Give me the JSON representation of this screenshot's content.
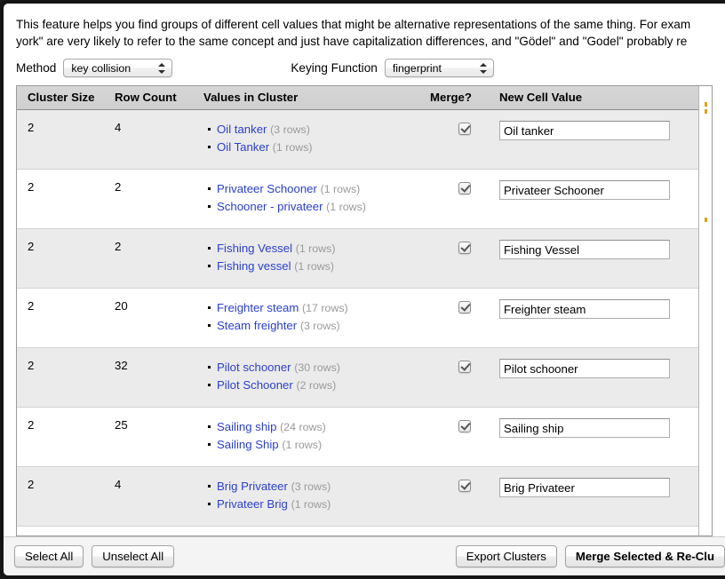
{
  "intro": {
    "line1": "This feature helps you find groups of different cell values that might be alternative representations of the same thing. For exam",
    "line2": "york\" are very likely to refer to the same concept and just have capitalization differences, and \"Gödel\" and \"Godel\" probably re"
  },
  "controls": {
    "method_label": "Method",
    "method_value": "key collision",
    "keying_label": "Keying Function",
    "keying_value": "fingerprint"
  },
  "table": {
    "headers": {
      "cluster_size": "Cluster Size",
      "row_count": "Row Count",
      "values_in_cluster": "Values in Cluster",
      "merge": "Merge?",
      "new_cell_value": "New Cell Value"
    },
    "rows": [
      {
        "cluster_size": "2",
        "row_count": "4",
        "values": [
          {
            "name": "Oil tanker",
            "rows": "(3 rows)"
          },
          {
            "name": "Oil Tanker",
            "rows": "(1 rows)"
          }
        ],
        "merge_checked": true,
        "new_value": "Oil tanker"
      },
      {
        "cluster_size": "2",
        "row_count": "2",
        "values": [
          {
            "name": "Privateer Schooner",
            "rows": "(1 rows)"
          },
          {
            "name": "Schooner - privateer",
            "rows": "(1 rows)"
          }
        ],
        "merge_checked": true,
        "new_value": "Privateer Schooner"
      },
      {
        "cluster_size": "2",
        "row_count": "2",
        "values": [
          {
            "name": "Fishing Vessel",
            "rows": "(1 rows)"
          },
          {
            "name": "Fishing vessel",
            "rows": "(1 rows)"
          }
        ],
        "merge_checked": true,
        "new_value": "Fishing Vessel"
      },
      {
        "cluster_size": "2",
        "row_count": "20",
        "values": [
          {
            "name": "Freighter steam",
            "rows": "(17 rows)"
          },
          {
            "name": "Steam freighter",
            "rows": "(3 rows)"
          }
        ],
        "merge_checked": true,
        "new_value": "Freighter steam"
      },
      {
        "cluster_size": "2",
        "row_count": "32",
        "values": [
          {
            "name": "Pilot schooner",
            "rows": "(30 rows)"
          },
          {
            "name": "Pilot Schooner",
            "rows": "(2 rows)"
          }
        ],
        "merge_checked": true,
        "new_value": "Pilot schooner"
      },
      {
        "cluster_size": "2",
        "row_count": "25",
        "values": [
          {
            "name": "Sailing ship",
            "rows": "(24 rows)"
          },
          {
            "name": "Sailing Ship",
            "rows": "(1 rows)"
          }
        ],
        "merge_checked": true,
        "new_value": "Sailing ship"
      },
      {
        "cluster_size": "2",
        "row_count": "4",
        "values": [
          {
            "name": "Brig Privateer",
            "rows": "(3 rows)"
          },
          {
            "name": "Privateer Brig",
            "rows": "(1 rows)"
          }
        ],
        "merge_checked": true,
        "new_value": "Brig Privateer"
      }
    ]
  },
  "footer": {
    "select_all": "Select All",
    "unselect_all": "Unselect All",
    "export_clusters": "Export Clusters",
    "merge_selected": "Merge Selected & Re-Clu"
  },
  "colors": {
    "value_link": "#2a3fd0",
    "row_count_muted": "#9a9a9a",
    "header_bg": "#d2d2d2",
    "stripe_bg": "#ebebeb",
    "frame": "#141414"
  }
}
